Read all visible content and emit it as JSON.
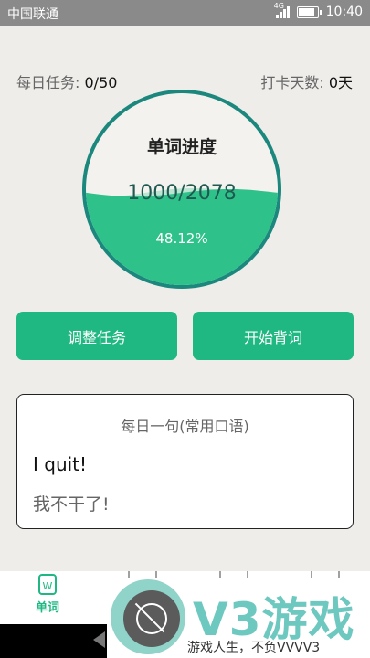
{
  "status_bar": {
    "carrier": "中国联通",
    "network": "4G",
    "time": "10:40"
  },
  "stats": {
    "daily_task_label": "每日任务:",
    "daily_task_value": "0/50",
    "checkin_label": "打卡天数:",
    "checkin_value": "0天"
  },
  "progress": {
    "title": "单词进度",
    "count": "1000/2078",
    "percent": "48.12%",
    "fraction": 0.4812,
    "wave_color": "#2ec28a",
    "ring_color": "#1b877d"
  },
  "buttons": {
    "adjust_task": "调整任务",
    "start_memorize": "开始背词",
    "color": "#1fb882"
  },
  "daily_sentence": {
    "title": "每日一句(常用口语)",
    "english": "I quit!",
    "chinese": "我不干了!"
  },
  "tabbar": {
    "home_icon": "word-book-icon",
    "home_label": "单词",
    "home_icon_letter": "W"
  },
  "watermark": {
    "title": "V3游戏",
    "subtitle": "游戏人生，不负VVVV3"
  }
}
